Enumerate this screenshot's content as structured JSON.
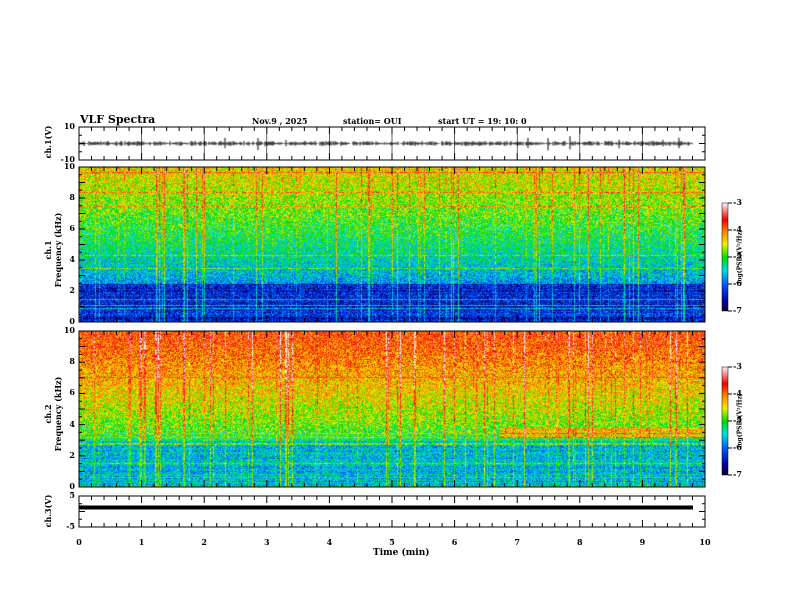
{
  "header": {
    "title": "VLF Spectra",
    "date": "Nov.9  , 2025",
    "station": "station= OUI",
    "start": "start  UT =   19: 10: 0"
  },
  "chart_data": [
    {
      "type": "line",
      "ylabel": "ch.1(V)",
      "ylim": [
        -10,
        10
      ],
      "yticks": [
        "10",
        "-10"
      ],
      "xlim": [
        0,
        10
      ],
      "trace_level": 0,
      "color": "#000000"
    },
    {
      "type": "heatmap",
      "ylabel_line1": "ch.1",
      "ylabel_line2": "Frequency  (kHz)",
      "ylim": [
        0,
        10
      ],
      "yticks": [
        "0",
        "2",
        "4",
        "6",
        "8",
        "10"
      ],
      "xlim": [
        0,
        10
      ],
      "colorbar": {
        "label": "log(PSD)(V²/Hz)",
        "range": [
          -7,
          -3
        ],
        "ticks": [
          "-3",
          "-4",
          "-5",
          "-6",
          "-7"
        ]
      }
    },
    {
      "type": "heatmap",
      "ylabel_line1": "ch.2",
      "ylabel_line2": "Frequency  (kHz)",
      "ylim": [
        0,
        10
      ],
      "yticks": [
        "0",
        "2",
        "4",
        "6",
        "8",
        "10"
      ],
      "xlim": [
        0,
        10
      ],
      "colorbar": {
        "label": "log(PSD)(V²/Hz)",
        "range": [
          -7,
          -3
        ],
        "ticks": [
          "-3",
          "-4",
          "-5",
          "-6",
          "-7"
        ]
      }
    },
    {
      "type": "line",
      "ylabel": "ch.3(V)",
      "ylim": [
        -5,
        5
      ],
      "yticks": [
        "5",
        "-5"
      ],
      "xlim": [
        0,
        10
      ],
      "trace_level": 0,
      "color": "#000000"
    }
  ],
  "xaxis": {
    "label": "Time  (min)",
    "ticks": [
      "0",
      "1",
      "2",
      "3",
      "4",
      "5",
      "6",
      "7",
      "8",
      "9",
      "10"
    ]
  }
}
